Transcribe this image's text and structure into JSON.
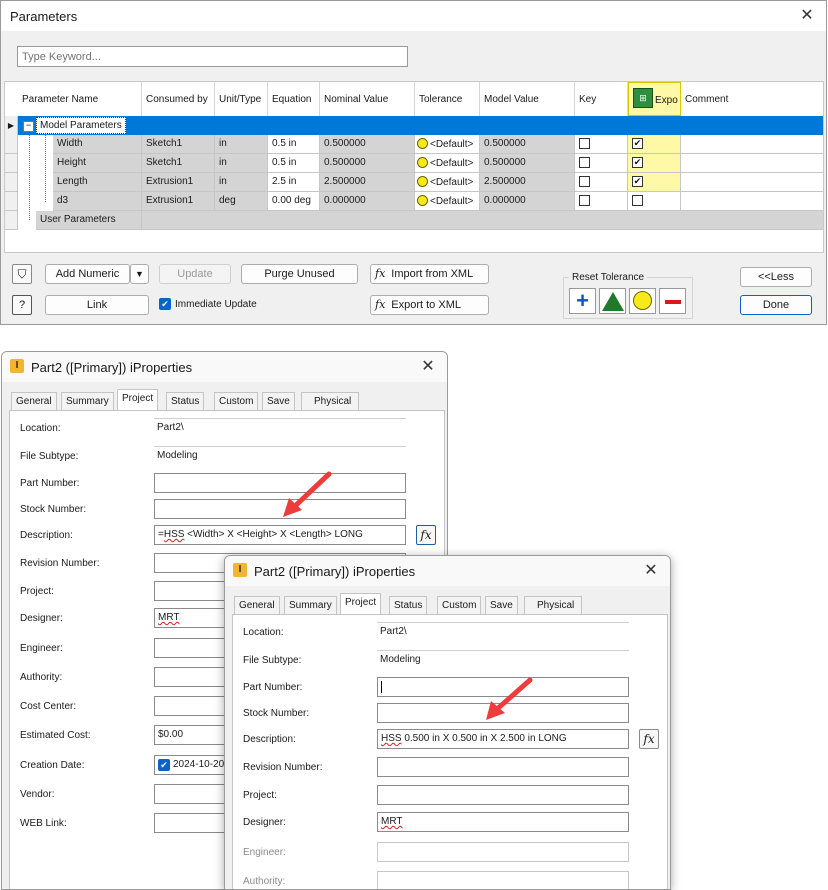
{
  "params": {
    "title": "Parameters",
    "search_placeholder": "Type Keyword...",
    "columns": {
      "name": "Parameter Name",
      "consumed": "Consumed by",
      "unit": "Unit/Type",
      "equation": "Equation",
      "nominal": "Nominal Value",
      "tolerance": "Tolerance",
      "model": "Model Value",
      "key": "Key",
      "export": "Expo",
      "comment": "Comment"
    },
    "group_model": "Model Parameters",
    "group_user": "User Parameters",
    "rows": [
      {
        "name": "Width",
        "consumed": "Sketch1",
        "unit": "in",
        "equation": "0.5 in",
        "nominal": "0.500000",
        "tolerance": "<Default>",
        "model": "0.500000",
        "export": "✔"
      },
      {
        "name": "Height",
        "consumed": "Sketch1",
        "unit": "in",
        "equation": "0.5 in",
        "nominal": "0.500000",
        "tolerance": "<Default>",
        "model": "0.500000",
        "export": "✔"
      },
      {
        "name": "Length",
        "consumed": "Extrusion1",
        "unit": "in",
        "equation": "2.5 in",
        "nominal": "2.500000",
        "tolerance": "<Default>",
        "model": "2.500000",
        "export": "✔"
      },
      {
        "name": "d3",
        "consumed": "Extrusion1",
        "unit": "deg",
        "equation": "0.00 deg",
        "nominal": "0.000000",
        "tolerance": "<Default>",
        "model": "0.000000",
        "export": ""
      }
    ],
    "buttons": {
      "add_numeric": "Add Numeric",
      "update": "Update",
      "purge": "Purge Unused",
      "import_xml": "Import from XML",
      "link": "Link",
      "immediate_update": "Immediate Update",
      "export_xml": "Export to XML",
      "reset_tolerance": "Reset Tolerance",
      "less": "<<Less",
      "done": "Done"
    }
  },
  "iprops": {
    "title": "Part2 ([Primary]) iProperties",
    "tabs": [
      "General",
      "Summary",
      "Project",
      "Status",
      "Custom",
      "Save",
      "Physical"
    ],
    "labels": {
      "location": "Location:",
      "subtype": "File Subtype:",
      "part_number": "Part Number:",
      "stock_number": "Stock Number:",
      "description": "Description:",
      "revision": "Revision Number:",
      "project": "Project:",
      "designer": "Designer:",
      "engineer": "Engineer:",
      "authority": "Authority:",
      "cost_center": "Cost Center:",
      "est_cost": "Estimated Cost:",
      "creation_date": "Creation Date:",
      "vendor": "Vendor:",
      "web_link": "WEB Link:"
    },
    "values": {
      "location": "Part2\\",
      "subtype": "Modeling",
      "designer": "MRT",
      "est_cost": "$0.00",
      "creation_date": "2024-10-20"
    },
    "front_description_prefix": "=",
    "front_description_hss": "HSS",
    "front_description_rest": " <Width> X <Height> X <Length> LONG",
    "back_description_hss": "HSS",
    "back_description_rest": " 0.500 in X 0.500 in X 2.500 in LONG"
  },
  "colors": {
    "selection": "#0078d7",
    "export_highlight": "#fff8a6",
    "arrow": "#ee3b3b"
  }
}
